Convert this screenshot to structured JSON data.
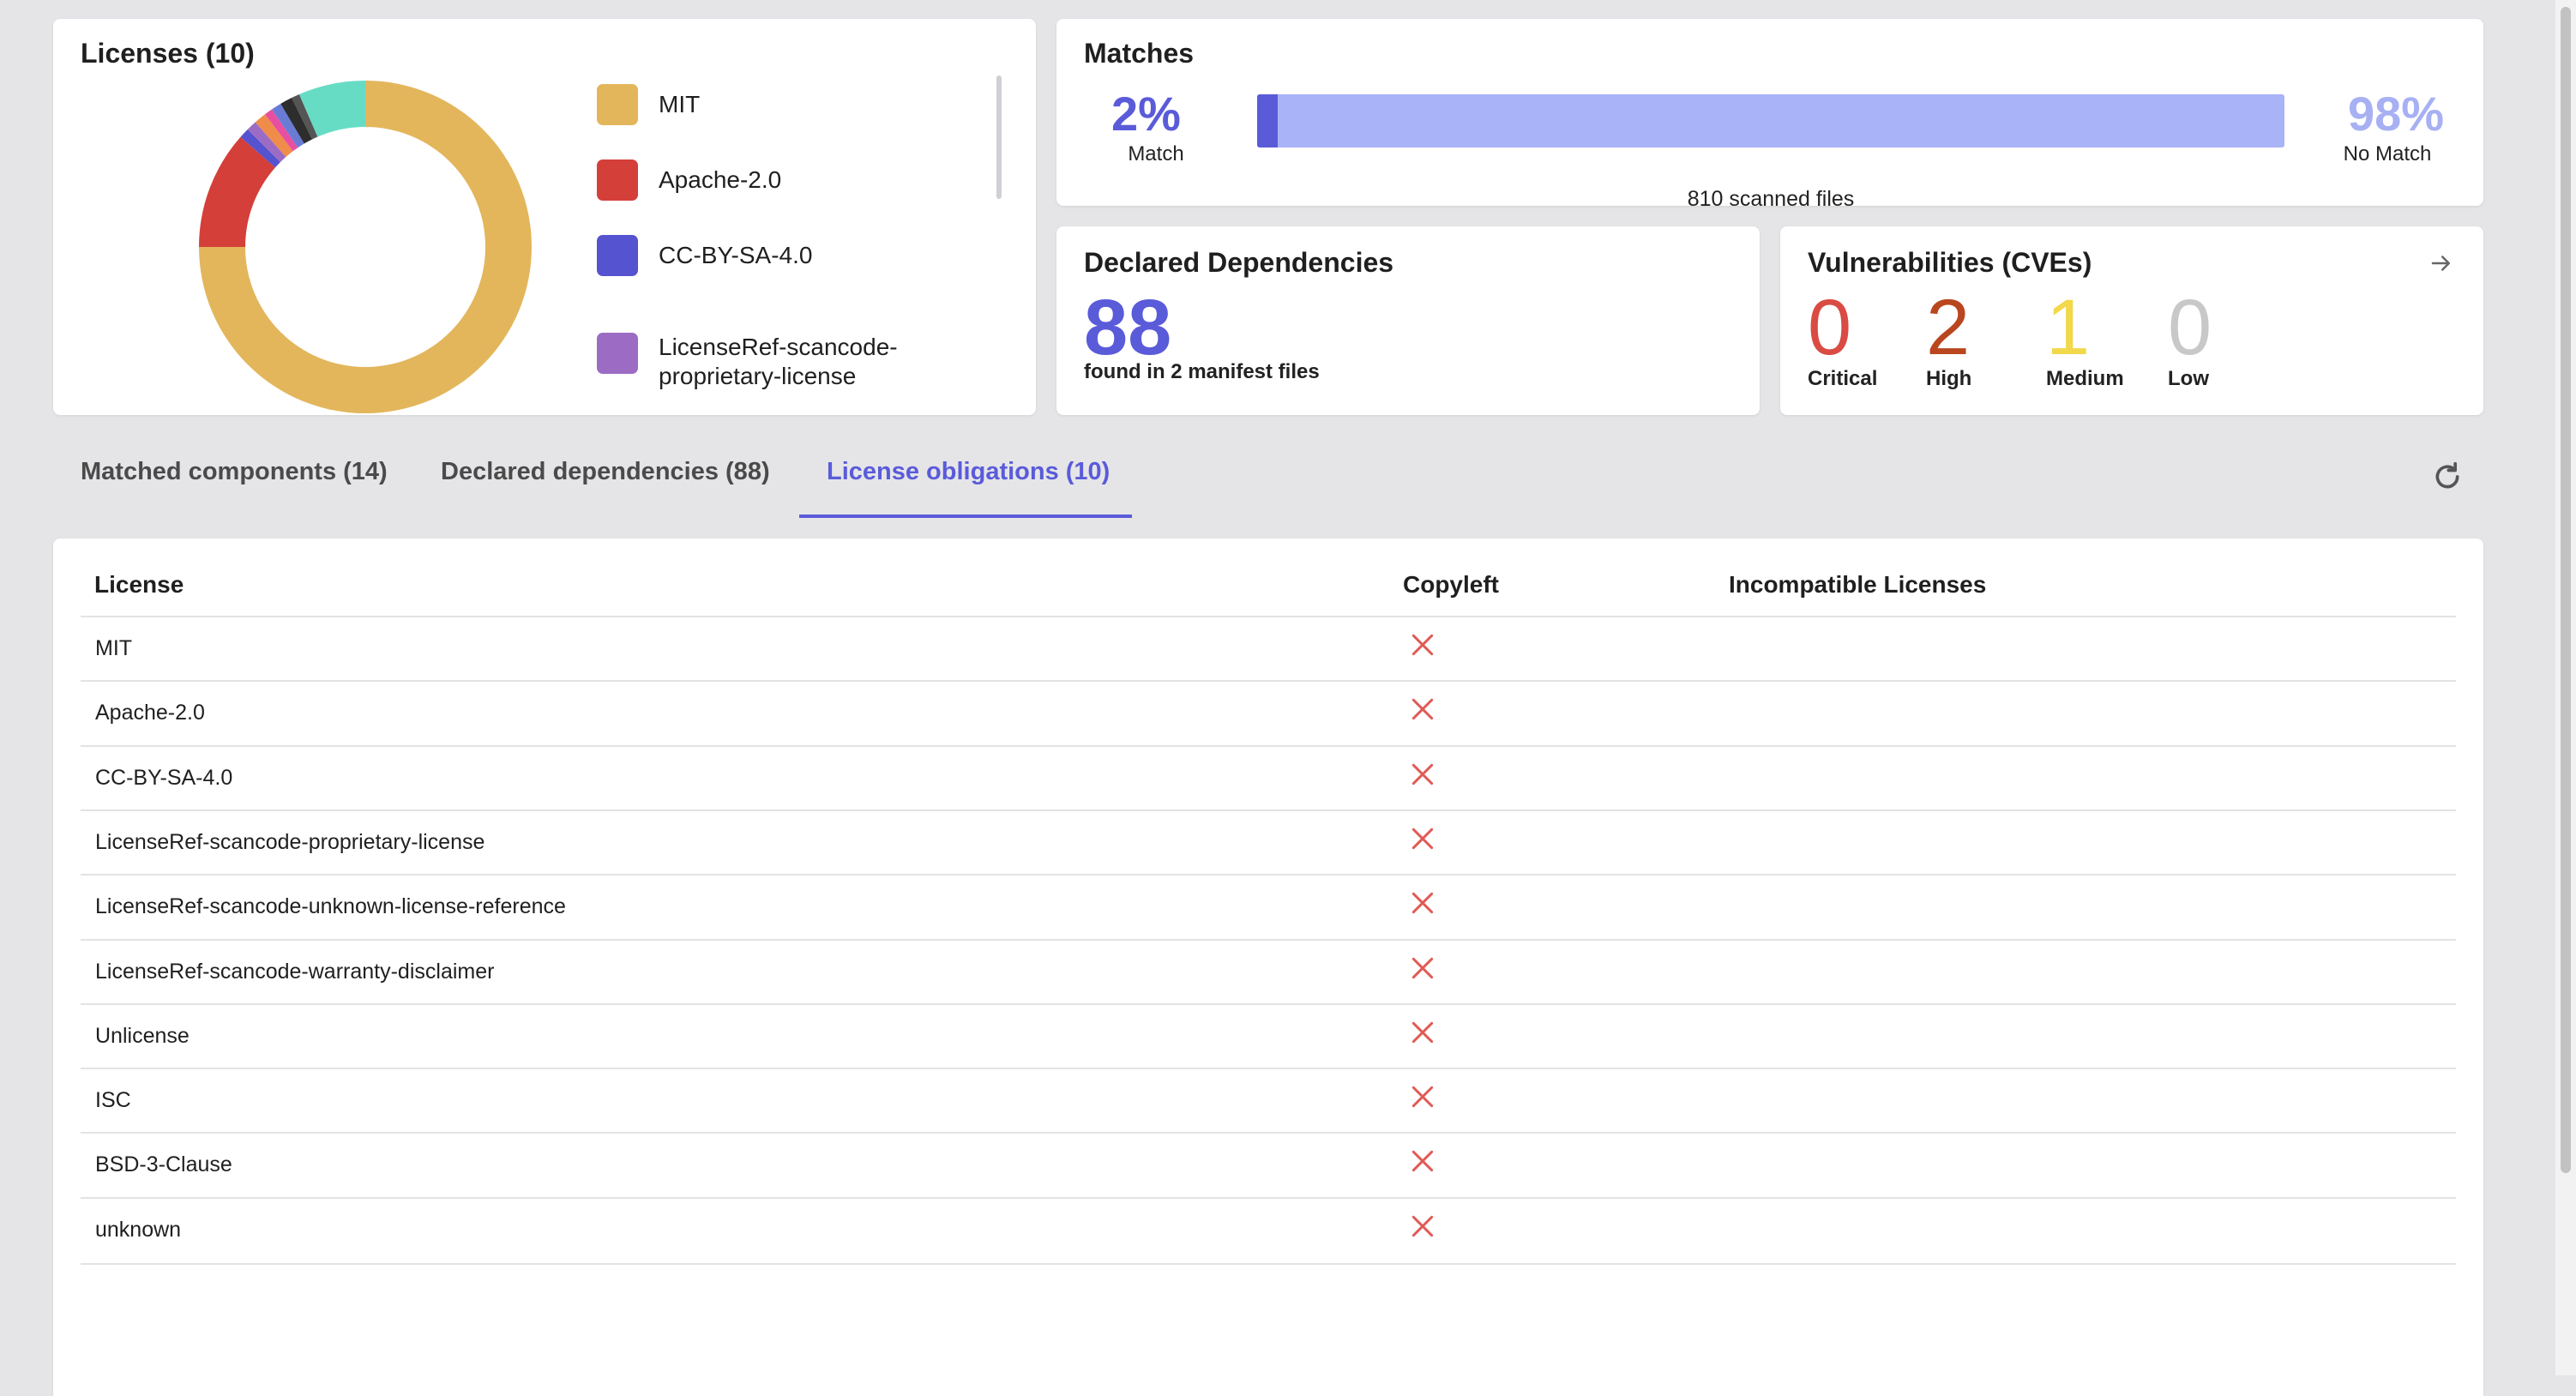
{
  "licenses": {
    "title": "Licenses (10)",
    "colors": [
      "#e3b65c",
      "#d43f3a",
      "#5553cf",
      "#9c6cc4",
      "#f08c4a",
      "#e84fa0",
      "#6a7bd6",
      "#2d2d2d",
      "#555555",
      "#67dcc5"
    ],
    "slices": [
      0.75,
      0.115,
      0.01,
      0.01,
      0.012,
      0.008,
      0.01,
      0.012,
      0.008,
      0.065
    ],
    "legend": [
      {
        "label": "MIT",
        "color": "#e3b65c"
      },
      {
        "label": "Apache-2.0",
        "color": "#d43f3a"
      },
      {
        "label": "CC-BY-SA-4.0",
        "color": "#5553cf"
      },
      {
        "label": "LicenseRef-scancode-proprietary-license",
        "color": "#9c6cc4"
      }
    ]
  },
  "matches": {
    "title": "Matches",
    "match_pct": "2%",
    "match_label": "Match",
    "nomatch_pct": "98%",
    "nomatch_label": "No Match",
    "match_fraction": 0.02,
    "scanned_text": "810 scanned files"
  },
  "dependencies": {
    "title": "Declared Dependencies",
    "count": "88",
    "subtitle": "found in 2 manifest files"
  },
  "vulnerabilities": {
    "title": "Vulnerabilities (CVEs)",
    "items": [
      {
        "count": "0",
        "label": "Critical",
        "color": "#d94b43"
      },
      {
        "count": "2",
        "label": "High",
        "color": "#b9461f"
      },
      {
        "count": "1",
        "label": "Medium",
        "color": "#f2d84a"
      },
      {
        "count": "0",
        "label": "Low",
        "color": "#c8c8c8"
      }
    ]
  },
  "tabs": [
    {
      "label": "Matched components (14)"
    },
    {
      "label": "Declared dependencies (88)"
    },
    {
      "label": "License obligations (10)"
    }
  ],
  "table": {
    "headers": {
      "license": "License",
      "copyleft": "Copyleft",
      "incompatible": "Incompatible Licenses"
    },
    "rows": [
      {
        "license": "MIT",
        "copyleft": false
      },
      {
        "license": "Apache-2.0",
        "copyleft": false
      },
      {
        "license": "CC-BY-SA-4.0",
        "copyleft": false
      },
      {
        "license": "LicenseRef-scancode-proprietary-license",
        "copyleft": false
      },
      {
        "license": "LicenseRef-scancode-unknown-license-reference",
        "copyleft": false
      },
      {
        "license": "LicenseRef-scancode-warranty-disclaimer",
        "copyleft": false
      },
      {
        "license": "Unlicense",
        "copyleft": false
      },
      {
        "license": "ISC",
        "copyleft": false
      },
      {
        "license": "BSD-3-Clause",
        "copyleft": false
      },
      {
        "license": "unknown",
        "copyleft": false
      }
    ]
  },
  "colors": {
    "accent": "#5a5bd9",
    "bar_bg": "#a9b3f7",
    "x_mark": "#e05a55"
  }
}
